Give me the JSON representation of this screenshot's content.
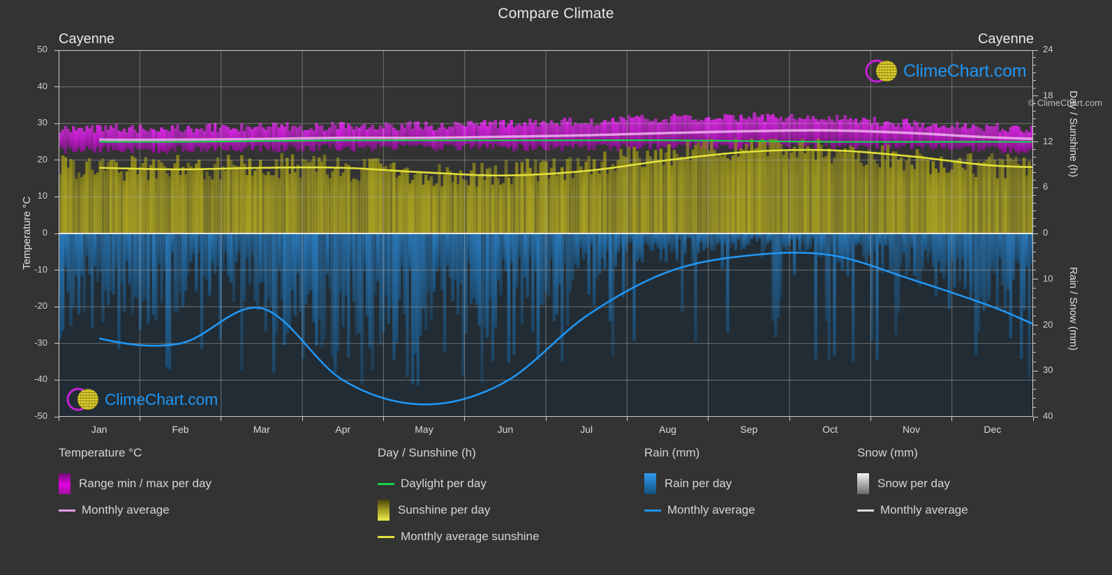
{
  "header": {
    "title": "Compare Climate"
  },
  "city_left": "Cayenne",
  "city_right": "Cayenne",
  "copyright": "© ClimeChart.com",
  "watermark": {
    "text": "ClimeChart.com"
  },
  "axes": {
    "left_title": "Temperature °C",
    "right_top_title": "Day / Sunshine (h)",
    "right_bottom_title": "Rain / Snow (mm)",
    "left_ticks": [
      "50",
      "40",
      "30",
      "20",
      "10",
      "0",
      "-10",
      "-20",
      "-30",
      "-40",
      "-50"
    ],
    "right_top_ticks": [
      "24",
      "18",
      "12",
      "6",
      "0"
    ],
    "right_bottom_ticks": [
      "0",
      "10",
      "20",
      "30",
      "40"
    ],
    "months": [
      "Jan",
      "Feb",
      "Mar",
      "Apr",
      "May",
      "Jun",
      "Jul",
      "Aug",
      "Sep",
      "Oct",
      "Nov",
      "Dec"
    ]
  },
  "legend": {
    "groups": [
      {
        "title": "Temperature °C",
        "items": [
          {
            "marker": "swatch",
            "color": "#e400e4",
            "label": "Range min / max per day",
            "name": "legend-temp-range"
          },
          {
            "marker": "line",
            "color": "#e79ce7",
            "label": "Monthly average",
            "name": "legend-temp-average"
          }
        ]
      },
      {
        "title": "Day / Sunshine (h)",
        "items": [
          {
            "marker": "line",
            "color": "#12d64a",
            "label": "Daylight per day",
            "name": "legend-daylight"
          },
          {
            "marker": "swatch",
            "color": "#e3e13a",
            "label": "Sunshine per day",
            "name": "legend-sunshine"
          },
          {
            "marker": "line",
            "color": "#e3e13a",
            "label": "Monthly average sunshine",
            "name": "legend-sunshine-average"
          }
        ]
      },
      {
        "title": "Rain (mm)",
        "items": [
          {
            "marker": "swatch",
            "color": "#1b88e0",
            "label": "Rain per day",
            "name": "legend-rain"
          },
          {
            "marker": "line",
            "color": "#2196f3",
            "label": "Monthly average",
            "name": "legend-rain-average"
          }
        ]
      },
      {
        "title": "Snow (mm)",
        "items": [
          {
            "marker": "swatch",
            "color": "#e8e8e8",
            "label": "Snow per day",
            "name": "legend-snow"
          },
          {
            "marker": "line",
            "color": "#dcdcdc",
            "label": "Monthly average",
            "name": "legend-snow-average"
          }
        ]
      }
    ]
  },
  "chart_data": {
    "type": "area",
    "title": "Compare Climate",
    "location": "Cayenne",
    "xlabel": "",
    "ylabel": "Temperature °C",
    "categories": [
      "Jan",
      "Feb",
      "Mar",
      "Apr",
      "May",
      "Jun",
      "Jul",
      "Aug",
      "Sep",
      "Oct",
      "Nov",
      "Dec"
    ],
    "axes": {
      "temperature_c": {
        "min": -50,
        "max": 50,
        "ticks": [
          50,
          40,
          30,
          20,
          10,
          0,
          -10,
          -20,
          -30,
          -40,
          -50
        ]
      },
      "day_sunshine_h": {
        "min": 0,
        "max": 24,
        "ticks": [
          24,
          18,
          12,
          6,
          0
        ],
        "maps_to_temperature": [
          0,
          50
        ]
      },
      "rain_snow_mm": {
        "min": 0,
        "max": 40,
        "ticks": [
          0,
          10,
          20,
          30,
          40
        ],
        "maps_to_temperature": [
          0,
          -50
        ]
      }
    },
    "grid": true,
    "legend_position": "below",
    "series": [
      {
        "name": "Monthly average temperature",
        "unit": "°C",
        "color": "#e79ce7",
        "values": [
          25.6,
          25.6,
          25.8,
          26.1,
          26.1,
          26.4,
          26.8,
          27.4,
          27.9,
          28.1,
          27.4,
          26.2
        ]
      },
      {
        "name": "Daily temperature range max",
        "unit": "°C",
        "color": "#e400e4",
        "values": [
          28.4,
          28.5,
          28.7,
          29.0,
          29.1,
          29.4,
          30.0,
          30.8,
          31.4,
          31.5,
          30.6,
          29.2
        ]
      },
      {
        "name": "Daily temperature range min",
        "unit": "°C",
        "color": "#b200b2",
        "values": [
          22.8,
          22.8,
          23.0,
          23.3,
          23.4,
          23.4,
          23.4,
          23.6,
          23.9,
          24.1,
          23.9,
          23.3
        ]
      },
      {
        "name": "Daylight per day",
        "unit": "h",
        "color": "#12d64a",
        "values": [
          12.0,
          12.0,
          12.1,
          12.2,
          12.2,
          12.2,
          12.2,
          12.2,
          12.1,
          12.0,
          12.0,
          12.0
        ]
      },
      {
        "name": "Monthly average sunshine",
        "unit": "h",
        "color": "#e3e13a",
        "values": [
          8.6,
          8.4,
          8.6,
          8.6,
          8.0,
          7.6,
          8.2,
          9.6,
          10.7,
          10.9,
          10.1,
          8.9
        ]
      },
      {
        "name": "Monthly average rain",
        "unit": "mm",
        "color": "#2196f3",
        "values": [
          22.9,
          24.0,
          16.3,
          32.0,
          37.3,
          32.4,
          18.0,
          8.4,
          4.8,
          4.7,
          10.0,
          16.0,
          24.4
        ]
      },
      {
        "name": "Monthly average snow",
        "unit": "mm",
        "color": "#dcdcdc",
        "values": [
          0,
          0,
          0,
          0,
          0,
          0,
          0,
          0,
          0,
          0,
          0,
          0
        ]
      }
    ]
  }
}
